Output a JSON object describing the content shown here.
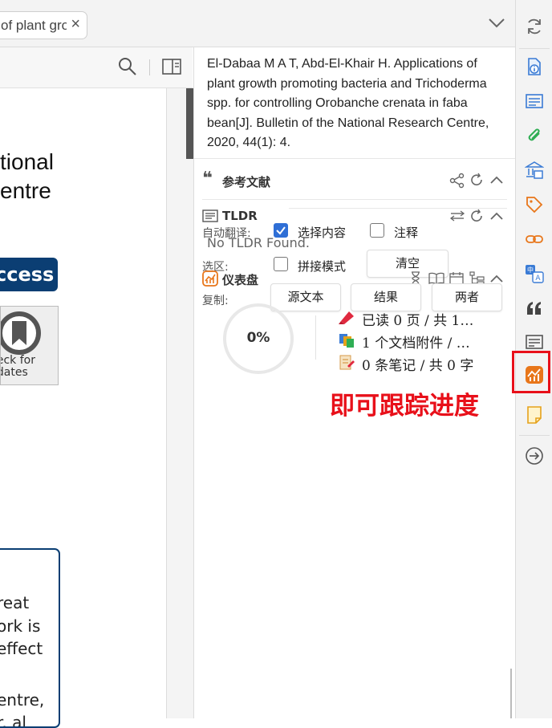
{
  "tab": {
    "title": "of plant gro",
    "close": "×"
  },
  "pdf": {
    "line1": "tional",
    "line2": "entre",
    "access": "ccess",
    "check_line1": "heck for",
    "check_line2": "pdates",
    "box_lines": [
      "reat",
      "ork is",
      "effect",
      "",
      "entre,",
      "r. al"
    ]
  },
  "citation": "El-Dabaa M A T, Abd-El-Khair H. Applications of plant growth promoting bacteria and Trichoderma spp. for controlling Orobanche crenata in faba bean[J]. Bulletin of the National Research Centre, 2020, 44(1): 4.",
  "references": {
    "title": "参考文献"
  },
  "tldr": {
    "title": "TLDR",
    "empty": "No TLDR Found."
  },
  "translate": {
    "auto_label": "自动翻译:",
    "select_content": "选择内容",
    "annotation": "注释",
    "selection_label": "选区:",
    "concat_mode": "拼接模式",
    "clear": "清空",
    "copy_label": "复制:",
    "source": "源文本",
    "result": "结果",
    "both": "两者"
  },
  "dashboard": {
    "title": "仪表盘",
    "progress": "0%",
    "progress_value": 0,
    "read": "已读 0 页 / 共 1…",
    "attachments": "1 个文档附件 / …",
    "notes": "0 条笔记 / 共 0 字"
  },
  "annotation_note": "即可跟踪进度",
  "colors": {
    "accent": "#2f6fd6",
    "highlight": "#e8101a",
    "journal": "#0b3e73"
  }
}
